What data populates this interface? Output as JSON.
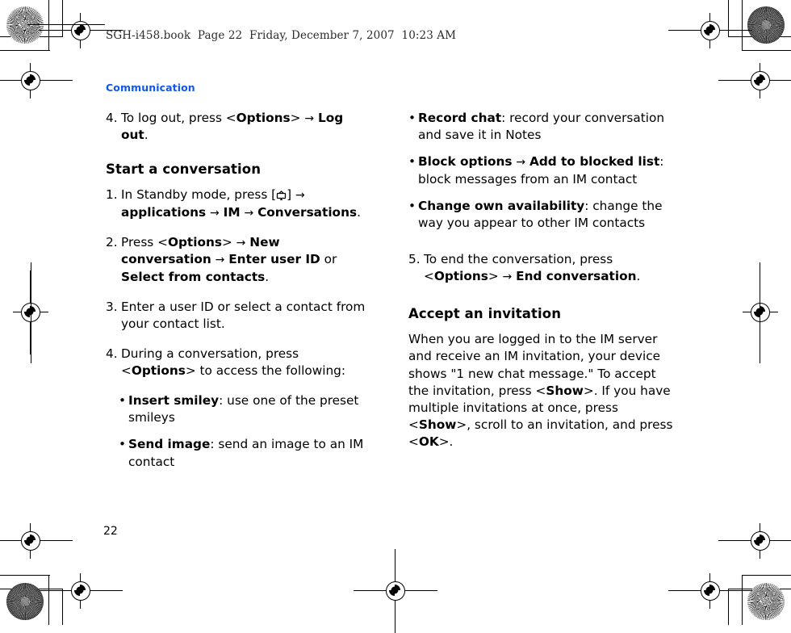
{
  "document": {
    "slug_line": "SGH-i458.book  Page 22  Friday, December 7, 2007  10:23 AM",
    "running_head": "Communication",
    "folio": "22",
    "accent_color": "#1157ee"
  },
  "left_column": {
    "step4_logout": {
      "number": "4.",
      "text_1": "To log out, press <",
      "bold_1": "Options",
      "text_2": ">",
      "arrow": "→",
      "bold_2": "Log out",
      "text_3": "."
    },
    "heading_start_conversation": "Start a conversation",
    "step1": {
      "number": "1.",
      "text_1": "In Standby mode, press [",
      "icon": "menu-key-icon",
      "text_2": "]",
      "arrow_1": "→",
      "bold_1": "applications",
      "arrow_2": "→",
      "bold_2": "IM",
      "arrow_3": "→",
      "bold_3": "Conversations",
      "text_3": "."
    },
    "step2": {
      "number": "2.",
      "text_1": "Press <",
      "bold_1": "Options",
      "text_2": ">",
      "arrow_1": "→",
      "bold_2": "New conversation",
      "arrow_2": "→",
      "bold_3": "Enter user ID",
      "text_3": "or",
      "bold_4": "Select from contacts",
      "text_4": "."
    },
    "step3": {
      "number": "3.",
      "text": "Enter a user ID or select a contact from your contact list."
    },
    "step4_options": {
      "number": "4.",
      "text_1": "During a conversation, press <",
      "bold_1": "Options",
      "text_2": "> to access the following:"
    },
    "bullets": [
      {
        "dot": "•",
        "bold": "Insert smiley",
        "text": ": use one of the preset smileys"
      },
      {
        "dot": "•",
        "bold": "Send image",
        "text": ": send an image to an IM contact"
      }
    ]
  },
  "right_column": {
    "bullets": [
      {
        "dot": "•",
        "bold": "Record chat",
        "text": ": record your conversation and save it in Notes"
      },
      {
        "dot": "•",
        "bold_1": "Block options",
        "arrow": "→",
        "bold_2": "Add to blocked list",
        "text": ": block messages from an IM contact"
      },
      {
        "dot": "•",
        "bold": "Change own availability",
        "text": ": change the way you appear to other IM contacts"
      }
    ],
    "step5": {
      "number": "5.",
      "text_1": "To end the conversation, press <",
      "bold_1": "Options",
      "text_2": ">",
      "arrow": "→",
      "bold_2": "End conversation",
      "text_3": "."
    },
    "heading_accept_invitation": "Accept an invitation",
    "paragraph": {
      "text_1": "When you are logged in to the IM server and receive an IM invitation, your device shows \"1 new chat message.\" To accept the invitation, press <",
      "bold_1": "Show",
      "text_2": ">. If you have multiple invitations at once, press <",
      "bold_2": "Show",
      "text_3": ">, scroll to an invitation, and press <",
      "bold_3": "OK",
      "text_4": ">."
    }
  }
}
